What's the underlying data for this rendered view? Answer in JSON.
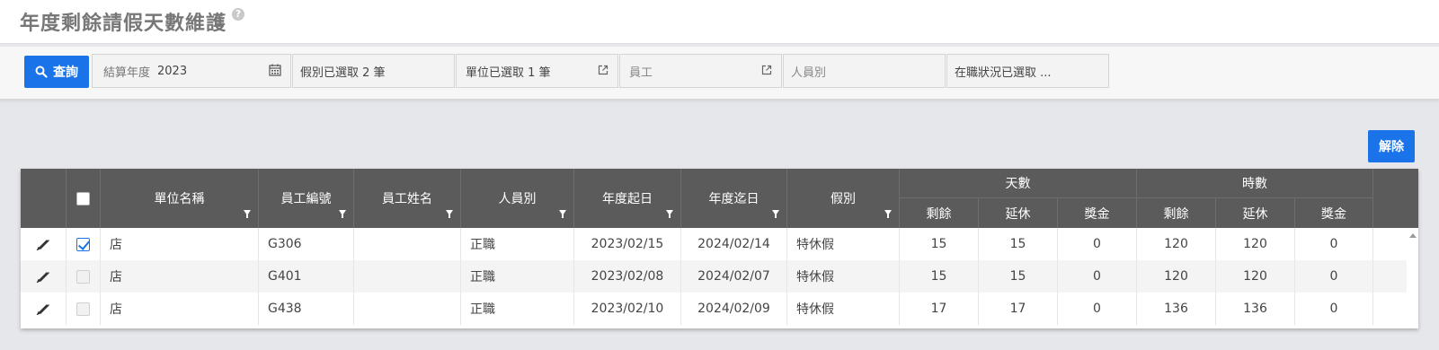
{
  "page": {
    "title": "年度剩餘請假天數維護",
    "help_icon": "?"
  },
  "filters": {
    "query_button": "查詢",
    "year_label": "結算年度",
    "year_value": "2023",
    "leave_type": "假別已選取 2 筆",
    "unit": "單位已選取 1 筆",
    "employee_placeholder": "員工",
    "staff_type_placeholder": "人員別",
    "status": "在職狀況已選取 ..."
  },
  "actions": {
    "unlock_button": "解除"
  },
  "table": {
    "headers": {
      "unit_name": "單位名稱",
      "emp_no": "員工編號",
      "emp_name": "員工姓名",
      "staff_type": "人員別",
      "year_start": "年度起日",
      "year_end": "年度迄日",
      "leave_type": "假別",
      "days_group": "天數",
      "hours_group": "時數",
      "remaining": "剩餘",
      "extended": "延休",
      "bonus": "獎金"
    },
    "rows": [
      {
        "checked": true,
        "unit_name": "店",
        "emp_no": "G306",
        "emp_name": "",
        "staff_type": "正職",
        "year_start": "2023/02/15",
        "year_end": "2024/02/14",
        "leave_type": "特休假",
        "days_remaining": "15",
        "days_extended": "15",
        "days_bonus": "0",
        "hours_remaining": "120",
        "hours_extended": "120",
        "hours_bonus": "0"
      },
      {
        "checked": false,
        "unit_name": "店",
        "emp_no": "G401",
        "emp_name": "",
        "staff_type": "正職",
        "year_start": "2023/02/08",
        "year_end": "2024/02/07",
        "leave_type": "特休假",
        "days_remaining": "15",
        "days_extended": "15",
        "days_bonus": "0",
        "hours_remaining": "120",
        "hours_extended": "120",
        "hours_bonus": "0"
      },
      {
        "checked": false,
        "unit_name": "店",
        "emp_no": "G438",
        "emp_name": "",
        "staff_type": "正職",
        "year_start": "2023/02/10",
        "year_end": "2024/02/09",
        "leave_type": "特休假",
        "days_remaining": "17",
        "days_extended": "17",
        "days_bonus": "0",
        "hours_remaining": "136",
        "hours_extended": "136",
        "hours_bonus": "0"
      }
    ]
  },
  "colors": {
    "accent": "#1a73e8",
    "header_bg": "#5b5b5b"
  },
  "icons": {
    "query": "search-icon",
    "calendar": "calendar-icon",
    "external": "external-link-icon",
    "edit": "edit-pencil-icon",
    "filter": "filter-icon",
    "help": "help-icon"
  }
}
